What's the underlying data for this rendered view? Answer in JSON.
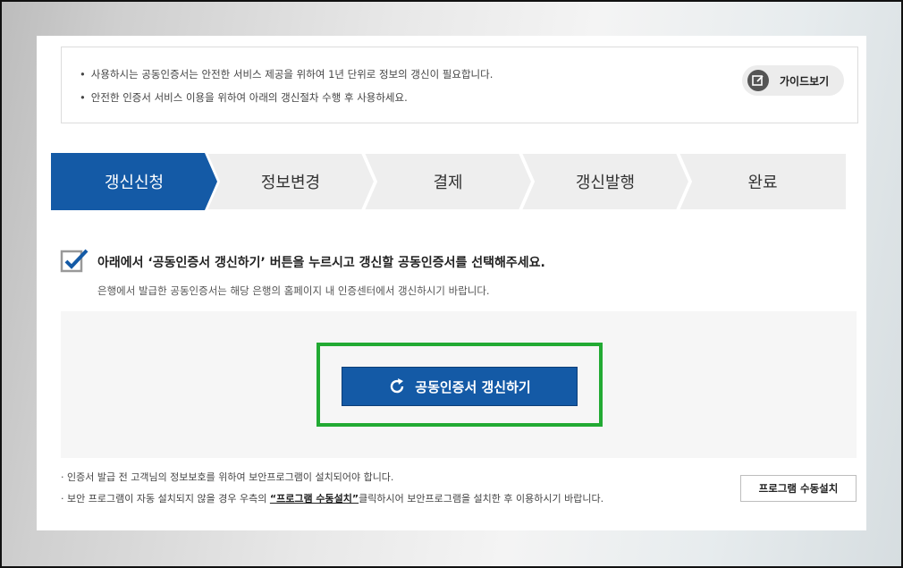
{
  "notice": {
    "line1": "사용하시는 공동인증서는 안전한 서비스 제공을 위하여 1년 단위로 정보의 갱신이 필요합니다.",
    "line2": "안전한 인증서 서비스 이용을 위하여 아래의 갱신절차 수행 후 사용하세요.",
    "bullet": "•"
  },
  "guide_button": {
    "label": "가이드보기",
    "icon": "edit-icon"
  },
  "steps": [
    {
      "label": "갱신신청",
      "active": true
    },
    {
      "label": "정보변경",
      "active": false
    },
    {
      "label": "결제",
      "active": false
    },
    {
      "label": "갱신발행",
      "active": false
    },
    {
      "label": "완료",
      "active": false
    }
  ],
  "instruction": {
    "title": "아래에서 ‘공동인증서 갱신하기’ 버튼을 누르시고 갱신할 공동인증서를 선택해주세요.",
    "sub": "은행에서 발급한 공동인증서는 해당 은행의 홈페이지 내 인증센터에서 갱신하시기 바랍니다."
  },
  "renew_button": {
    "label": "공동인증서 갱신하기",
    "icon": "refresh-icon"
  },
  "notes": {
    "bullet": "·",
    "line1": "인증서 발급 전 고객님의 정보보호를 위하여 보안프로그램이 설치되어야 합니다.",
    "line2_pre": "보안 프로그램이 자동 설치되지 않을 경우 우측의 ",
    "line2_link": "“프로그램 수동설치”",
    "line2_post": "클릭하시어 보안프로그램을 설치한 후 이용하시기 바랍니다."
  },
  "install_button": {
    "label": "프로그램 수동설치"
  },
  "colors": {
    "primary": "#145aa6",
    "highlight": "#22aa33",
    "step_inactive": "#eeeeee"
  }
}
